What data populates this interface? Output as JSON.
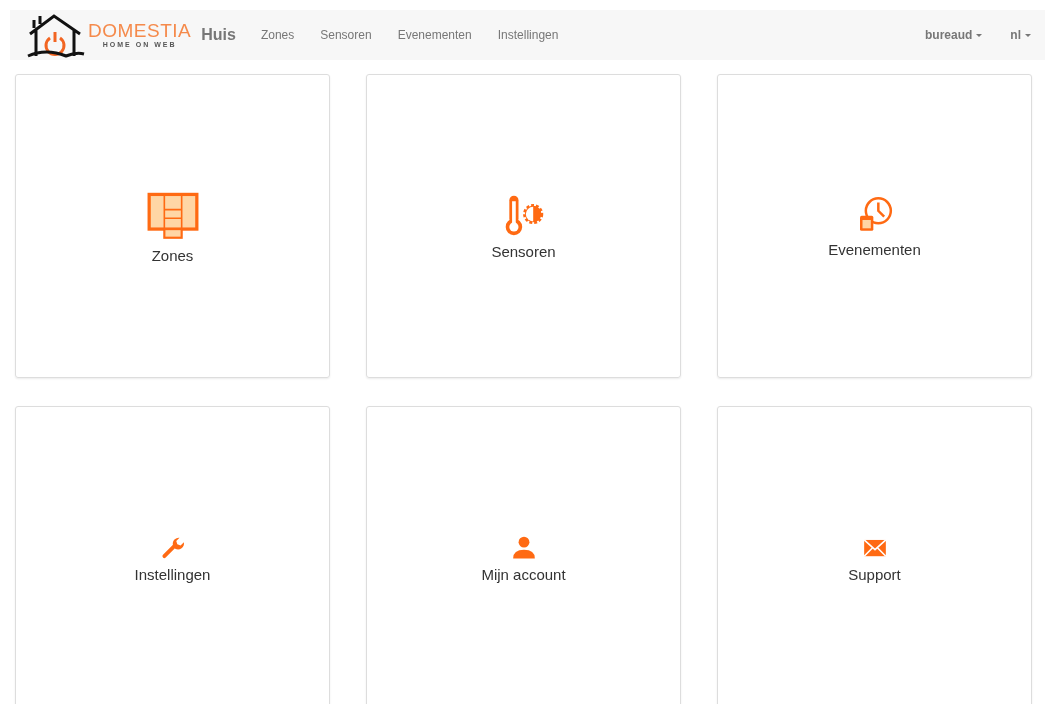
{
  "navbar": {
    "logo": {
      "name": "DOMESTIA",
      "tagline": "HOME ON WEB"
    },
    "brand": "Huis",
    "links": [
      "Zones",
      "Sensoren",
      "Evenementen",
      "Instellingen"
    ],
    "dropdowns": [
      "bureaud",
      "nl"
    ]
  },
  "tiles": [
    {
      "kind": "floorplan",
      "label": "Zones"
    },
    {
      "kind": "thermometer",
      "label": "Sensoren"
    },
    {
      "kind": "clock",
      "label": "Evenementen"
    },
    {
      "kind": "wrench",
      "label": "Instellingen"
    },
    {
      "kind": "user",
      "label": "Mijn account"
    },
    {
      "kind": "envelope",
      "label": "Support"
    }
  ]
}
